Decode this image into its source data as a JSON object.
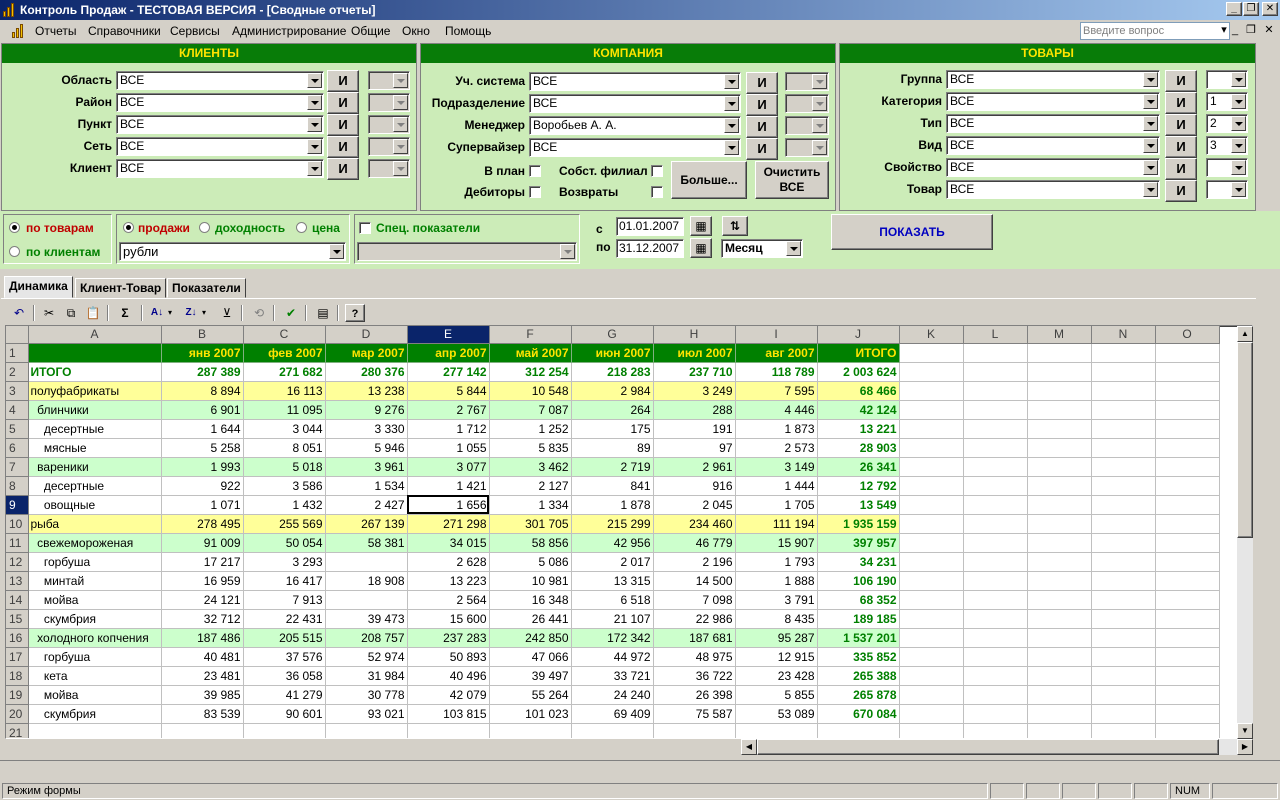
{
  "window": {
    "title": "Контроль Продаж - ТЕСТОВАЯ ВЕРСИЯ - [Сводные отчеты]"
  },
  "menu": {
    "items": [
      "Отчеты",
      "Справочники",
      "Сервисы",
      "Администрирование",
      "Общие",
      "Окно",
      "Помощь"
    ],
    "help_placeholder": "Введите вопрос"
  },
  "clients": {
    "header": "КЛИЕНТЫ",
    "fields": [
      {
        "label": "Область",
        "value": "ВСЕ"
      },
      {
        "label": "Район",
        "value": "ВСЕ"
      },
      {
        "label": "Пункт",
        "value": "ВСЕ"
      },
      {
        "label": "Сеть",
        "value": "ВСЕ"
      },
      {
        "label": "Клиент",
        "value": "ВСЕ"
      }
    ],
    "and_label": "И"
  },
  "company": {
    "header": "КОМПАНИЯ",
    "fields": [
      {
        "label": "Уч. система",
        "value": "ВСЕ"
      },
      {
        "label": "Подразделение",
        "value": "ВСЕ"
      },
      {
        "label": "Менеджер",
        "value": "Воробьев А. А."
      },
      {
        "label": "Супервайзер",
        "value": "ВСЕ"
      }
    ],
    "checks": {
      "in_plan": "В план",
      "debtors": "Дебиторы",
      "own_branch": "Собст. филиал",
      "returns": "Возвраты"
    },
    "more_button": "Больше...",
    "clear_button": "Очистить ВСЕ"
  },
  "goods": {
    "header": "ТОВАРЫ",
    "fields": [
      {
        "label": "Группа",
        "value": "ВСЕ",
        "level": ""
      },
      {
        "label": "Категория",
        "value": "ВСЕ",
        "level": "1"
      },
      {
        "label": "Тип",
        "value": "ВСЕ",
        "level": "2"
      },
      {
        "label": "Вид",
        "value": "ВСЕ",
        "level": "3"
      },
      {
        "label": "Свойство",
        "value": "ВСЕ",
        "level": ""
      },
      {
        "label": "Товар",
        "value": "ВСЕ",
        "level": ""
      }
    ]
  },
  "options": {
    "by_goods": "по товарам",
    "by_clients": "по клиентам",
    "sales": "продажи",
    "profit": "доходность",
    "price": "цена",
    "currency": "рубли",
    "special": "Спец. показатели",
    "from_label": "с",
    "to_label": "по",
    "date_from": "01.01.2007",
    "date_to": "31.12.2007",
    "period": "Месяц",
    "show_button": "ПОКАЗАТЬ"
  },
  "tabs": [
    "Динамика",
    "Клиент-Товар",
    "Показатели"
  ],
  "sheet": {
    "columns": [
      "A",
      "B",
      "C",
      "D",
      "E",
      "F",
      "G",
      "H",
      "I",
      "J",
      "K",
      "L",
      "M",
      "N",
      "O"
    ],
    "selected_col": "E",
    "selected_row": 9,
    "header_row": [
      "",
      "янв 2007",
      "фев 2007",
      "мар 2007",
      "апр 2007",
      "май 2007",
      "июн 2007",
      "июл 2007",
      "авг 2007",
      "ИТОГО"
    ],
    "rows": [
      {
        "n": 2,
        "kind": "total",
        "name": "ИТОГО",
        "vals": [
          "287 389",
          "271 682",
          "280 376",
          "277 142",
          "312 254",
          "218 283",
          "237 710",
          "118 789",
          "2 003 624"
        ]
      },
      {
        "n": 3,
        "kind": "cat1",
        "name": "полуфабрикаты",
        "vals": [
          "8 894",
          "16 113",
          "13 238",
          "5 844",
          "10 548",
          "2 984",
          "3 249",
          "7 595",
          "68 466"
        ]
      },
      {
        "n": 4,
        "kind": "cat2",
        "name": "  блинчики",
        "vals": [
          "6 901",
          "11 095",
          "9 276",
          "2 767",
          "7 087",
          "264",
          "288",
          "4 446",
          "42 124"
        ]
      },
      {
        "n": 5,
        "kind": "item",
        "name": "    десертные",
        "vals": [
          "1 644",
          "3 044",
          "3 330",
          "1 712",
          "1 252",
          "175",
          "191",
          "1 873",
          "13 221"
        ]
      },
      {
        "n": 6,
        "kind": "item",
        "name": "    мясные",
        "vals": [
          "5 258",
          "8 051",
          "5 946",
          "1 055",
          "5 835",
          "89",
          "97",
          "2 573",
          "28 903"
        ]
      },
      {
        "n": 7,
        "kind": "cat2",
        "name": "  вареники",
        "vals": [
          "1 993",
          "5 018",
          "3 961",
          "3 077",
          "3 462",
          "2 719",
          "2 961",
          "3 149",
          "26 341"
        ]
      },
      {
        "n": 8,
        "kind": "item",
        "name": "    десертные",
        "vals": [
          "922",
          "3 586",
          "1 534",
          "1 421",
          "2 127",
          "841",
          "916",
          "1 444",
          "12 792"
        ]
      },
      {
        "n": 9,
        "kind": "item",
        "name": "    овощные",
        "vals": [
          "1 071",
          "1 432",
          "2 427",
          "1 656",
          "1 334",
          "1 878",
          "2 045",
          "1 705",
          "13 549"
        ]
      },
      {
        "n": 10,
        "kind": "cat1",
        "name": "рыба",
        "vals": [
          "278 495",
          "255 569",
          "267 139",
          "271 298",
          "301 705",
          "215 299",
          "234 460",
          "111 194",
          "1 935 159"
        ]
      },
      {
        "n": 11,
        "kind": "cat2",
        "name": "  свежемороженая",
        "vals": [
          "91 009",
          "50 054",
          "58 381",
          "34 015",
          "58 856",
          "42 956",
          "46 779",
          "15 907",
          "397 957"
        ]
      },
      {
        "n": 12,
        "kind": "item",
        "name": "    горбуша",
        "vals": [
          "17 217",
          "3 293",
          "",
          "2 628",
          "5 086",
          "2 017",
          "2 196",
          "1 793",
          "34 231"
        ]
      },
      {
        "n": 13,
        "kind": "item",
        "name": "    минтай",
        "vals": [
          "16 959",
          "16 417",
          "18 908",
          "13 223",
          "10 981",
          "13 315",
          "14 500",
          "1 888",
          "106 190"
        ]
      },
      {
        "n": 14,
        "kind": "item",
        "name": "    мойва",
        "vals": [
          "24 121",
          "7 913",
          "",
          "2 564",
          "16 348",
          "6 518",
          "7 098",
          "3 791",
          "68 352"
        ]
      },
      {
        "n": 15,
        "kind": "item",
        "name": "    скумбрия",
        "vals": [
          "32 712",
          "22 431",
          "39 473",
          "15 600",
          "26 441",
          "21 107",
          "22 986",
          "8 435",
          "189 185"
        ]
      },
      {
        "n": 16,
        "kind": "cat2",
        "name": "  холодного копчения",
        "vals": [
          "187 486",
          "205 515",
          "208 757",
          "237 283",
          "242 850",
          "172 342",
          "187 681",
          "95 287",
          "1 537 201"
        ]
      },
      {
        "n": 17,
        "kind": "item",
        "name": "    горбуша",
        "vals": [
          "40 481",
          "37 576",
          "52 974",
          "50 893",
          "47 066",
          "44 972",
          "48 975",
          "12 915",
          "335 852"
        ]
      },
      {
        "n": 18,
        "kind": "item",
        "name": "    кета",
        "vals": [
          "23 481",
          "36 058",
          "31 984",
          "40 496",
          "39 497",
          "33 721",
          "36 722",
          "23 428",
          "265 388"
        ]
      },
      {
        "n": 19,
        "kind": "item",
        "name": "    мойва",
        "vals": [
          "39 985",
          "41 279",
          "30 778",
          "42 079",
          "55 264",
          "24 240",
          "26 398",
          "5 855",
          "265 878"
        ]
      },
      {
        "n": 20,
        "kind": "item",
        "name": "    скумбрия",
        "vals": [
          "83 539",
          "90 601",
          "93 021",
          "103 815",
          "101 023",
          "69 409",
          "75 587",
          "53 089",
          "670 084"
        ]
      }
    ],
    "last_row_number": 21
  },
  "status": {
    "mode": "Режим формы",
    "num": "NUM"
  }
}
